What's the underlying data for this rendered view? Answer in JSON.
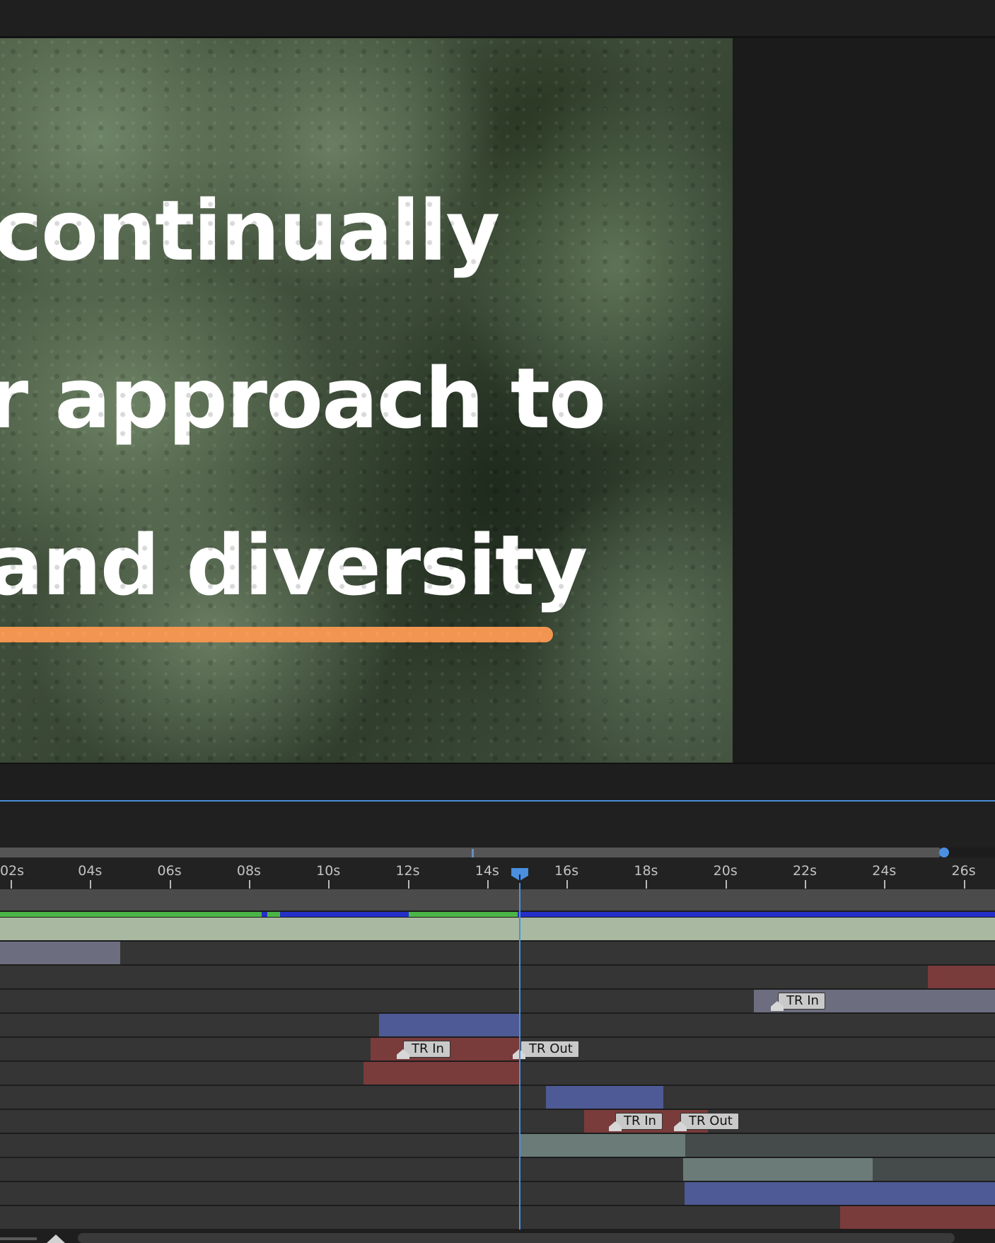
{
  "viewer": {
    "lines": [
      "continually",
      "r approach to",
      "and diversity"
    ],
    "underline_color": "#f29550"
  },
  "timeline": {
    "ticks": [
      {
        "label": "02s"
      },
      {
        "label": "04s"
      },
      {
        "label": "06s"
      },
      {
        "label": "08s"
      },
      {
        "label": "10s"
      },
      {
        "label": "12s"
      },
      {
        "label": "14s"
      },
      {
        "label": "16s"
      },
      {
        "label": "18s"
      },
      {
        "label": "20s"
      },
      {
        "label": "22s"
      },
      {
        "label": "24s"
      },
      {
        "label": "26s"
      }
    ],
    "markers": {
      "tr_in": "TR In",
      "tr_out": "TR Out"
    },
    "colors": {
      "playhead": "#4a90e2",
      "cache_rendered": "#4bb547",
      "cache_ram": "#2430c8",
      "layer_red": "#7a3b3b",
      "layer_blue": "#4e5a95",
      "layer_lavender": "#6d6d80",
      "layer_sage": "#6b7c78"
    }
  }
}
